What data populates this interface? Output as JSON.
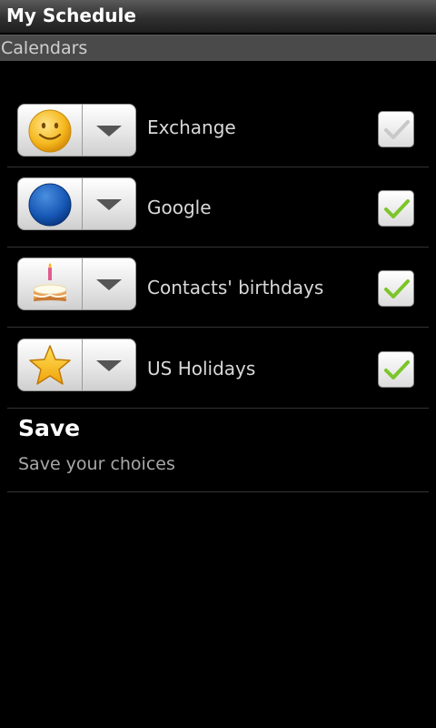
{
  "titlebar": {
    "title": "My Schedule"
  },
  "section": {
    "label": "Calendars"
  },
  "calendars": [
    {
      "name": "Exchange",
      "icon": "smiley-icon",
      "checked": false
    },
    {
      "name": "Google",
      "icon": "blue-circle-icon",
      "checked": true
    },
    {
      "name": "Contacts' birthdays",
      "icon": "birthday-cake-icon",
      "checked": true
    },
    {
      "name": "US Holidays",
      "icon": "star-icon",
      "checked": true
    }
  ],
  "save": {
    "title": "Save",
    "subtitle": "Save your choices"
  },
  "colors": {
    "check_active": "#7cc52a",
    "check_inactive": "#c8c8c8"
  }
}
